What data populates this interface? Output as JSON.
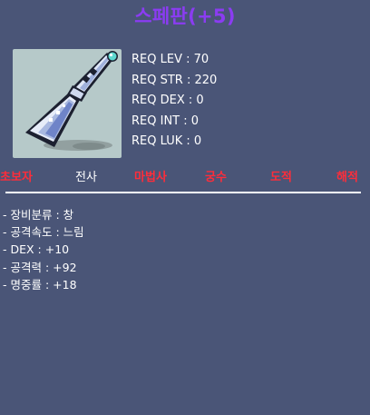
{
  "item": {
    "name": "스페판(+5)",
    "image_icon": "spear-icon"
  },
  "requirements": [
    "REQ LEV : 70",
    "REQ STR : 220",
    "REQ DEX : 0",
    "REQ INT : 0",
    "REQ LUK : 0"
  ],
  "jobs": [
    {
      "label": "초보자",
      "active": false
    },
    {
      "label": "전사",
      "active": true
    },
    {
      "label": "마법사",
      "active": false
    },
    {
      "label": "궁수",
      "active": false
    },
    {
      "label": "도적",
      "active": false
    },
    {
      "label": "해적",
      "active": false
    }
  ],
  "stats": [
    "- 장비분류 : 창",
    "- 공격속도 : 느림",
    "- DEX : +10",
    "- 공격력 : +92",
    "- 명중률 : +18"
  ],
  "colors": {
    "background": "#4a5577",
    "title": "#8b3cf2",
    "job_available": "#ffffff",
    "job_unavailable": "#ff2d3a",
    "image_background": "#b6c9c9"
  }
}
